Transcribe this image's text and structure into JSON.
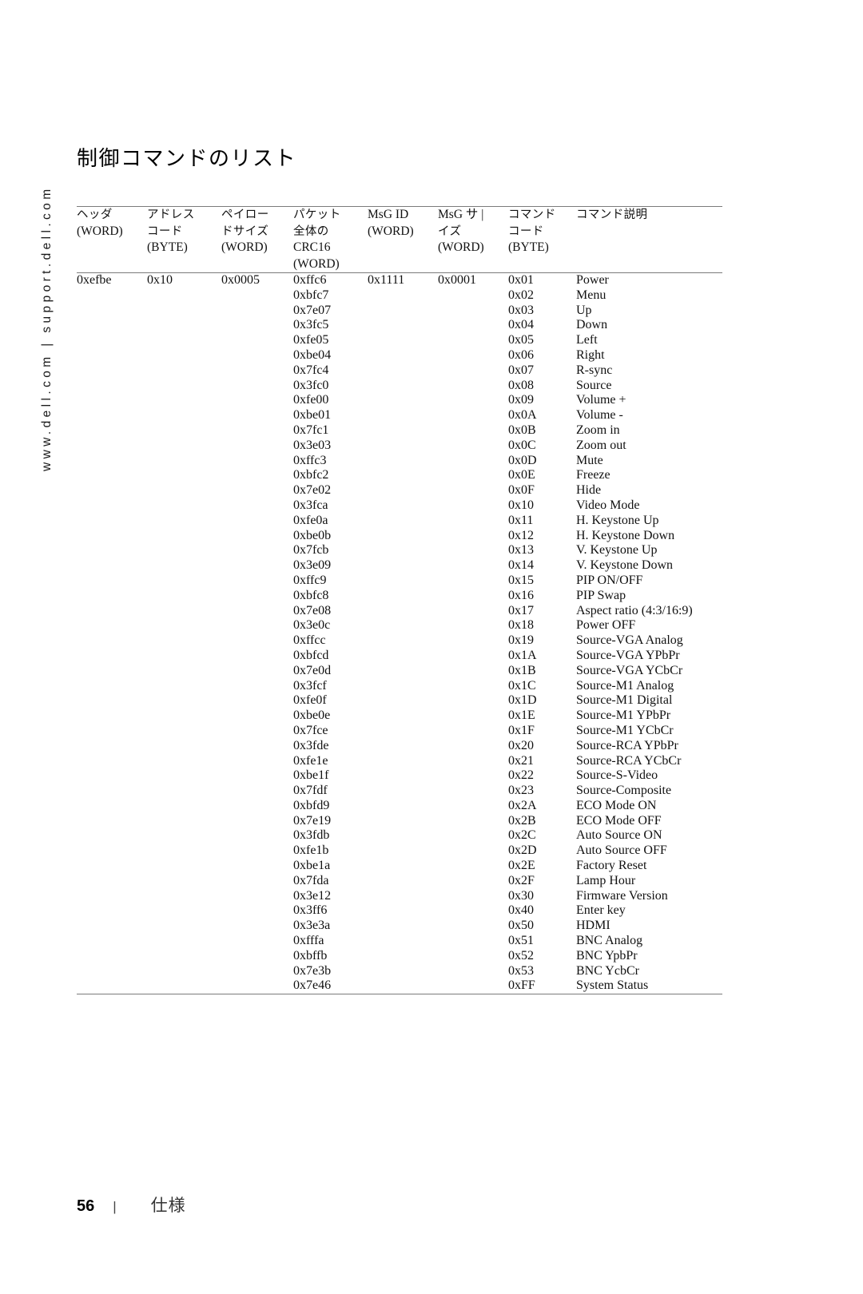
{
  "sidebar": {
    "text": "www.dell.com | support.dell.com"
  },
  "page": {
    "title": "制御コマンドのリスト"
  },
  "table": {
    "headers": [
      {
        "jp": "ヘッダ",
        "en": "(WORD)",
        "extra": ""
      },
      {
        "jp": "アドレス",
        "jp2": "コード",
        "en": "(BYTE)"
      },
      {
        "jp": "ペイロー",
        "jp2": "ドサイズ",
        "en": "(WORD)"
      },
      {
        "jp": "パケット",
        "jp2": "全体の",
        "en2": "CRC16",
        "en": "(WORD)"
      },
      {
        "jp": "MsG ID",
        "en": "(WORD)"
      },
      {
        "jp": "MsG サ |",
        "jp2": "イズ",
        "en": "(WORD)"
      },
      {
        "jp": "コマンド",
        "jp2": "コード",
        "en": "(BYTE)"
      },
      {
        "jp": "コマンド説明"
      }
    ],
    "header_col1_line1": "ヘッダ",
    "header_col1_line2": "(WORD)",
    "header_col2_line1": "アドレス",
    "header_col2_line2": "コード",
    "header_col2_line3": "(BYTE)",
    "header_col3_line1": "ペイロー",
    "header_col3_line2": "ドサイズ",
    "header_col3_line3": "(WORD)",
    "header_col4_line1": "パケット",
    "header_col4_line2": "全体の",
    "header_col4_line3": "CRC16",
    "header_col4_line4": "(WORD)",
    "header_col5_line1": "MsG ID",
    "header_col5_line2": "(WORD)",
    "header_col6_line1": "MsG サ |",
    "header_col6_line2": "イズ",
    "header_col6_line3": "(WORD)",
    "header_col7_line1": "コマンド",
    "header_col7_line2": "コード",
    "header_col7_line3": "(BYTE)",
    "header_col8_line1": "コマンド説明",
    "header_value": "0xefbe",
    "address_code": "0x10",
    "payload_size": "0x0005",
    "msg_id": "0x1111",
    "msg_size": "0x0001",
    "rows": [
      {
        "crc16": "0xffc6",
        "command_code": "0x01",
        "description": "Power"
      },
      {
        "crc16": "0xbfc7",
        "command_code": "0x02",
        "description": "Menu"
      },
      {
        "crc16": "0x7e07",
        "command_code": "0x03",
        "description": "Up"
      },
      {
        "crc16": "0x3fc5",
        "command_code": "0x04",
        "description": "Down"
      },
      {
        "crc16": "0xfe05",
        "command_code": "0x05",
        "description": "Left"
      },
      {
        "crc16": "0xbe04",
        "command_code": "0x06",
        "description": "Right"
      },
      {
        "crc16": "0x7fc4",
        "command_code": "0x07",
        "description": "R-sync"
      },
      {
        "crc16": "0x3fc0",
        "command_code": "0x08",
        "description": "Source"
      },
      {
        "crc16": "0xfe00",
        "command_code": "0x09",
        "description": "Volume +"
      },
      {
        "crc16": "0xbe01",
        "command_code": "0x0A",
        "description": "Volume -"
      },
      {
        "crc16": "0x7fc1",
        "command_code": "0x0B",
        "description": "Zoom in"
      },
      {
        "crc16": "0x3e03",
        "command_code": "0x0C",
        "description": "Zoom out"
      },
      {
        "crc16": "0xffc3",
        "command_code": "0x0D",
        "description": "Mute"
      },
      {
        "crc16": "0xbfc2",
        "command_code": "0x0E",
        "description": "Freeze"
      },
      {
        "crc16": "0x7e02",
        "command_code": "0x0F",
        "description": "Hide"
      },
      {
        "crc16": "0x3fca",
        "command_code": "0x10",
        "description": "Video Mode"
      },
      {
        "crc16": "0xfe0a",
        "command_code": "0x11",
        "description": "H. Keystone Up"
      },
      {
        "crc16": "0xbe0b",
        "command_code": "0x12",
        "description": "H. Keystone Down"
      },
      {
        "crc16": "0x7fcb",
        "command_code": "0x13",
        "description": "V. Keystone Up"
      },
      {
        "crc16": "0x3e09",
        "command_code": "0x14",
        "description": "V. Keystone Down"
      },
      {
        "crc16": "0xffc9",
        "command_code": "0x15",
        "description": "PIP ON/OFF"
      },
      {
        "crc16": "0xbfc8",
        "command_code": "0x16",
        "description": "PIP Swap"
      },
      {
        "crc16": "0x7e08",
        "command_code": "0x17",
        "description": "Aspect ratio (4:3/16:9)"
      },
      {
        "crc16": "0x3e0c",
        "command_code": "0x18",
        "description": "Power OFF"
      },
      {
        "crc16": "0xffcc",
        "command_code": "0x19",
        "description": "Source-VGA Analog"
      },
      {
        "crc16": "0xbfcd",
        "command_code": "0x1A",
        "description": "Source-VGA YPbPr"
      },
      {
        "crc16": "0x7e0d",
        "command_code": "0x1B",
        "description": "Source-VGA YCbCr"
      },
      {
        "crc16": "0x3fcf",
        "command_code": "0x1C",
        "description": "Source-M1 Analog"
      },
      {
        "crc16": "0xfe0f",
        "command_code": "0x1D",
        "description": "Source-M1 Digital"
      },
      {
        "crc16": "0xbe0e",
        "command_code": "0x1E",
        "description": "Source-M1 YPbPr"
      },
      {
        "crc16": "0x7fce",
        "command_code": "0x1F",
        "description": "Source-M1 YCbCr"
      },
      {
        "crc16": "0x3fde",
        "command_code": "0x20",
        "description": "Source-RCA YPbPr"
      },
      {
        "crc16": "0xfe1e",
        "command_code": "0x21",
        "description": "Source-RCA YCbCr"
      },
      {
        "crc16": "0xbe1f",
        "command_code": "0x22",
        "description": "Source-S-Video"
      },
      {
        "crc16": "0x7fdf",
        "command_code": "0x23",
        "description": "Source-Composite"
      },
      {
        "crc16": "0xbfd9",
        "command_code": "0x2A",
        "description": "ECO Mode ON"
      },
      {
        "crc16": "0x7e19",
        "command_code": "0x2B",
        "description": "ECO Mode OFF"
      },
      {
        "crc16": "0x3fdb",
        "command_code": "0x2C",
        "description": "Auto Source ON"
      },
      {
        "crc16": "0xfe1b",
        "command_code": "0x2D",
        "description": "Auto Source OFF"
      },
      {
        "crc16": "0xbe1a",
        "command_code": "0x2E",
        "description": "Factory Reset"
      },
      {
        "crc16": "0x7fda",
        "command_code": "0x2F",
        "description": "Lamp Hour"
      },
      {
        "crc16": "0x3e12",
        "command_code": "0x30",
        "description": "Firmware Version"
      },
      {
        "crc16": "0x3ff6",
        "command_code": "0x40",
        "description": "Enter key"
      },
      {
        "crc16": "0x3e3a",
        "command_code": "0x50",
        "description": "HDMI"
      },
      {
        "crc16": "0xfffa",
        "command_code": "0x51",
        "description": "BNC Analog"
      },
      {
        "crc16": "0xbffb",
        "command_code": "0x52",
        "description": "BNC YpbPr"
      },
      {
        "crc16": "0x7e3b",
        "command_code": "0x53",
        "description": "BNC YcbCr"
      },
      {
        "crc16": "0x7e46",
        "command_code": "0xFF",
        "description": "System Status"
      }
    ]
  },
  "footer": {
    "page_number": "56",
    "separator": "|",
    "section_label": "仕様"
  }
}
